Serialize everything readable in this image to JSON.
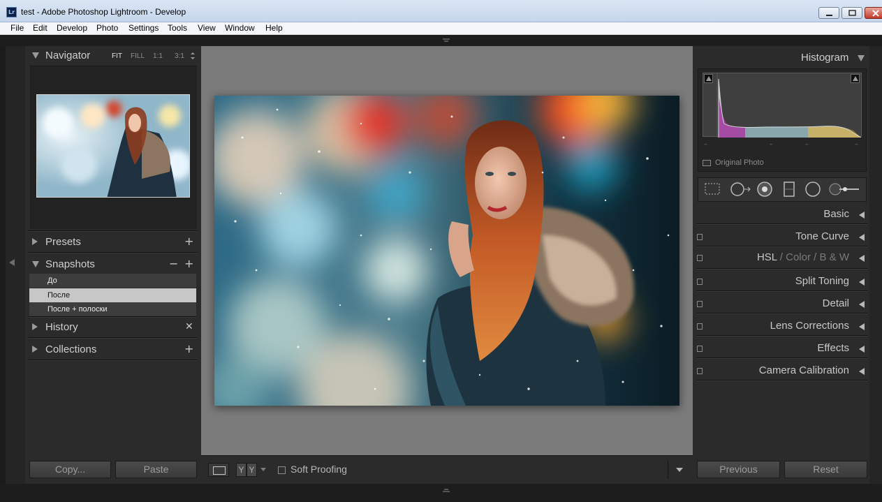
{
  "window": {
    "app_icon": "Lr",
    "title": "test - Adobe Photoshop Lightroom - Develop"
  },
  "menu": [
    "File",
    "Edit",
    "Develop",
    "Photo",
    "Settings",
    "Tools",
    "View",
    "Window",
    "Help"
  ],
  "left_panel": {
    "navigator": {
      "title": "Navigator",
      "zoom_options": [
        "FIT",
        "FILL",
        "1:1",
        "3:1"
      ],
      "active_zoom": "FIT"
    },
    "presets": {
      "title": "Presets"
    },
    "snapshots": {
      "title": "Snapshots",
      "items": [
        {
          "label": "До",
          "selected": false
        },
        {
          "label": "После",
          "selected": true
        },
        {
          "label": "После + полоски",
          "selected": false
        }
      ]
    },
    "history": {
      "title": "History"
    },
    "collections": {
      "title": "Collections"
    },
    "copy_button": "Copy...",
    "paste_button": "Paste"
  },
  "toolbar": {
    "view_y_1": "Y",
    "view_y_2": "Y",
    "soft_proofing_label": "Soft Proofing",
    "soft_proofing_checked": false
  },
  "right_panel": {
    "histogram": {
      "title": "Histogram",
      "original_photo_label": "Original Photo",
      "info_dashes": [
        "–",
        "–",
        "–",
        "–"
      ]
    },
    "panels": [
      {
        "key": "basic",
        "label": "Basic"
      },
      {
        "key": "tone_curve",
        "label": "Tone Curve"
      },
      {
        "key": "hsl",
        "label": "HSL"
      },
      {
        "key": "split_toning",
        "label": "Split Toning"
      },
      {
        "key": "detail",
        "label": "Detail"
      },
      {
        "key": "lens_corrections",
        "label": "Lens Corrections"
      },
      {
        "key": "effects",
        "label": "Effects"
      },
      {
        "key": "camera_calibration",
        "label": "Camera Calibration"
      }
    ],
    "hsl_parts": {
      "hsl": "HSL",
      "sep1": "/",
      "color": "Color",
      "sep2": "/",
      "bw": "B & W"
    },
    "previous_button": "Previous",
    "reset_button": "Reset"
  },
  "colors": {
    "panel_bg": "#2b2b2b",
    "center_bg": "#7b7b7b",
    "snapshot_selected_bg": "#c7c7c7"
  }
}
